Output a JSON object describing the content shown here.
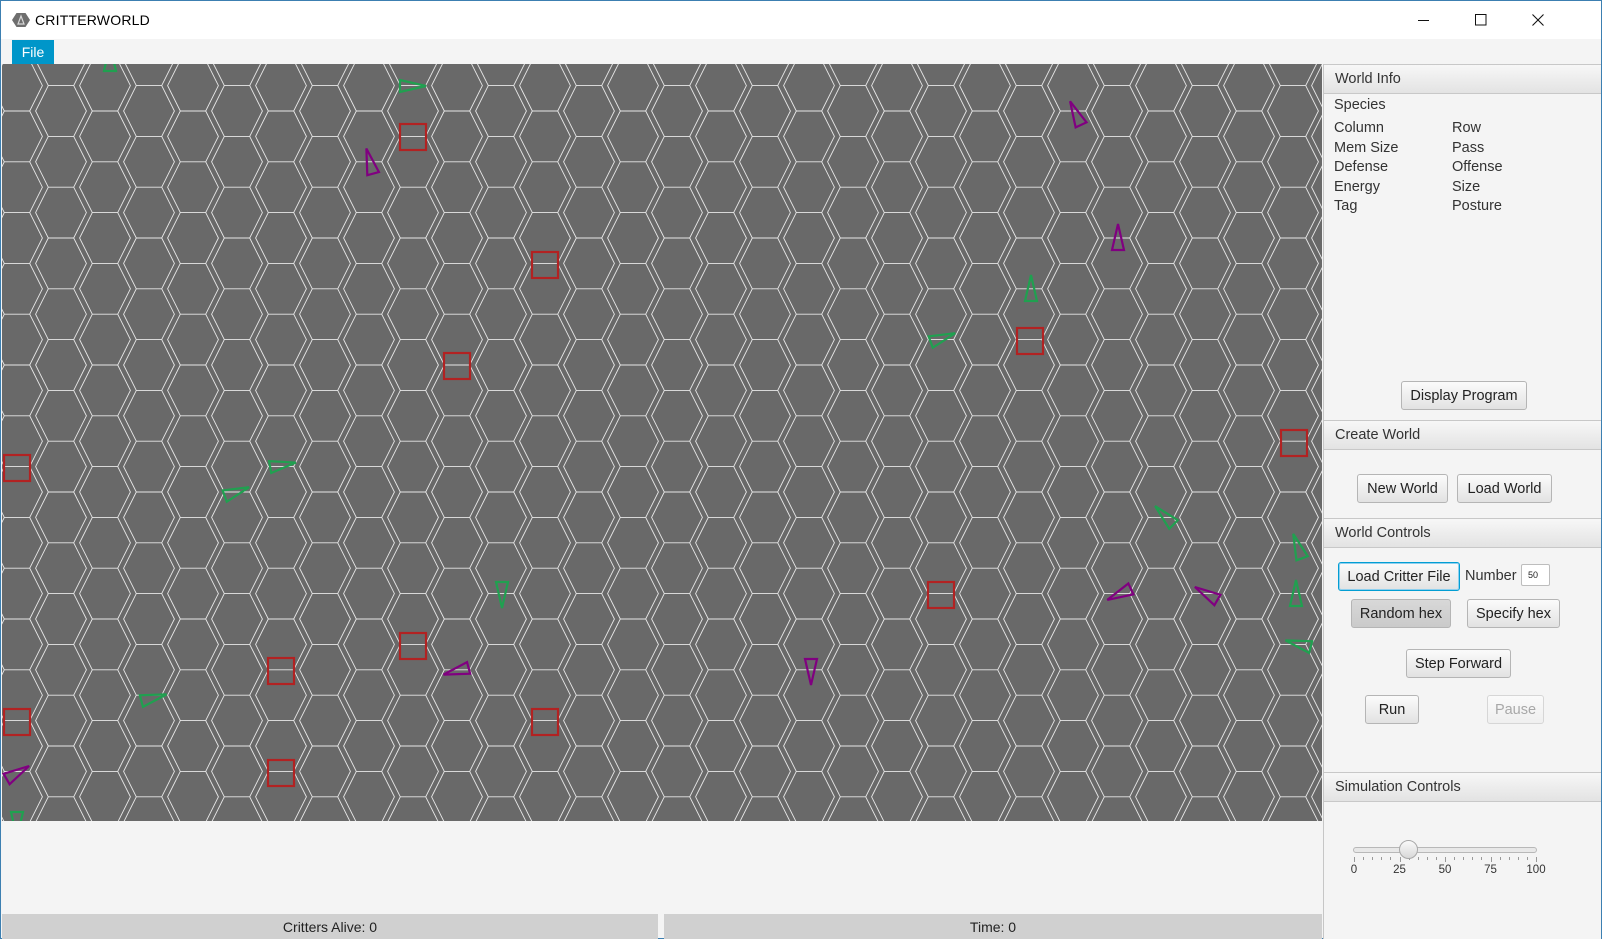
{
  "window": {
    "title": "CRITTERWORLD",
    "controls": [
      "minimize-icon",
      "maximize-icon",
      "close-icon"
    ]
  },
  "menu": {
    "file": "File"
  },
  "world": {
    "colors": {
      "background": "#696969",
      "grid": "#e8e8e8",
      "rock": "#b22222",
      "critter_green": "#20a050",
      "critter_purple": "#800080"
    }
  },
  "world_info": {
    "header": "World Info",
    "species_label": "Species",
    "fields_left": [
      "Column",
      "Mem Size",
      "Defense",
      "Energy",
      "Tag"
    ],
    "fields_right": [
      "Row",
      "Pass",
      "Offense",
      "Size",
      "Posture"
    ],
    "display_program_button": "Display Program"
  },
  "create_world": {
    "header": "Create World",
    "new_world_button": "New World",
    "load_world_button": "Load World"
  },
  "world_controls": {
    "header": "World Controls",
    "load_critter_button": "Load Critter File",
    "number_label": "Number",
    "number_value": "50",
    "random_hex_button": "Random hex",
    "specify_hex_button": "Specify hex",
    "step_forward_button": "Step Forward",
    "run_button": "Run",
    "pause_button": "Pause"
  },
  "simulation_controls": {
    "header": "Simulation Controls",
    "slider_value": 30,
    "slider_min": 0,
    "slider_max": 100,
    "tick_labels": [
      "0",
      "25",
      "50",
      "75",
      "100"
    ]
  },
  "status": {
    "critters_alive": "Critters Alive: 0",
    "time": "Time: 0"
  }
}
